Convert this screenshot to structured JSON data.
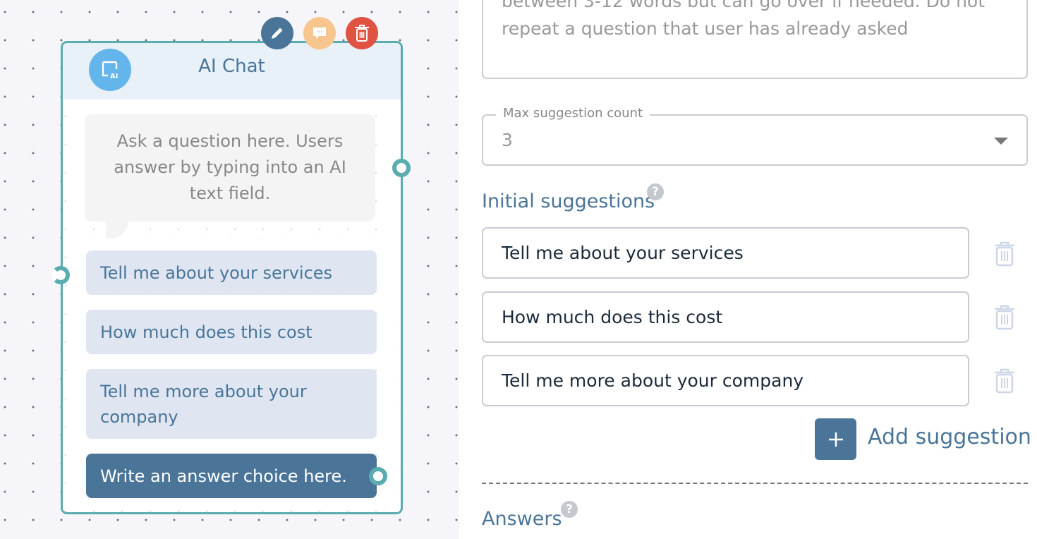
{
  "node": {
    "title": "AI Chat",
    "question": "Ask a question here. Users answer by typing into an AI text field.",
    "choices": [
      "Tell me about your services",
      "How much does this cost",
      "Tell me more about your company"
    ],
    "answer_placeholder": "Write an answer choice here.",
    "actions": [
      "edit",
      "comment",
      "delete"
    ],
    "colors": {
      "border": "#5aacb0",
      "edit": "#4a7598",
      "comment": "#f7c68e",
      "delete": "#e05242",
      "icon": "#64b5ec"
    }
  },
  "settings": {
    "prompt_text": "between 3-12 words but can go over if needed. Do not repeat a question that user has already asked",
    "max_suggestion_count": {
      "label": "Max suggestion count",
      "value": "3"
    },
    "initial_suggestions_heading": "Initial suggestions",
    "help_glyph": "?",
    "suggestions": [
      "Tell me about your services",
      "How much does this cost",
      "Tell me more about your company"
    ],
    "add_suggestion_label": "Add suggestion",
    "answers_heading": "Answers"
  }
}
